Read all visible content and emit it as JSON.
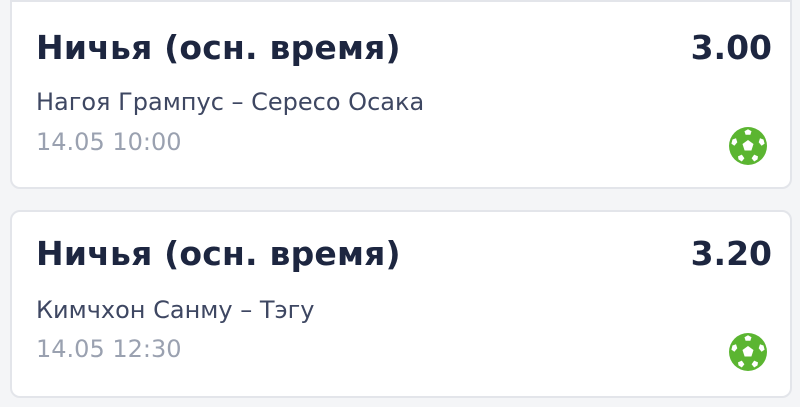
{
  "bets": [
    {
      "market": "Ничья (осн. время)",
      "odds": "3.00",
      "match": "Нагоя Грампус – Сересо Осака",
      "datetime": "14.05 10:00",
      "sport_icon": "soccer-ball-icon"
    },
    {
      "market": "Ничья (осн. время)",
      "odds": "3.20",
      "match": "Кимчхон Санму – Тэгу",
      "datetime": "14.05 12:30",
      "sport_icon": "soccer-ball-icon"
    }
  ],
  "colors": {
    "title": "#1d2640",
    "teams": "#3e4762",
    "date": "#9aa1b0",
    "icon": "#5bb531",
    "card_border": "#e3e5ea"
  }
}
